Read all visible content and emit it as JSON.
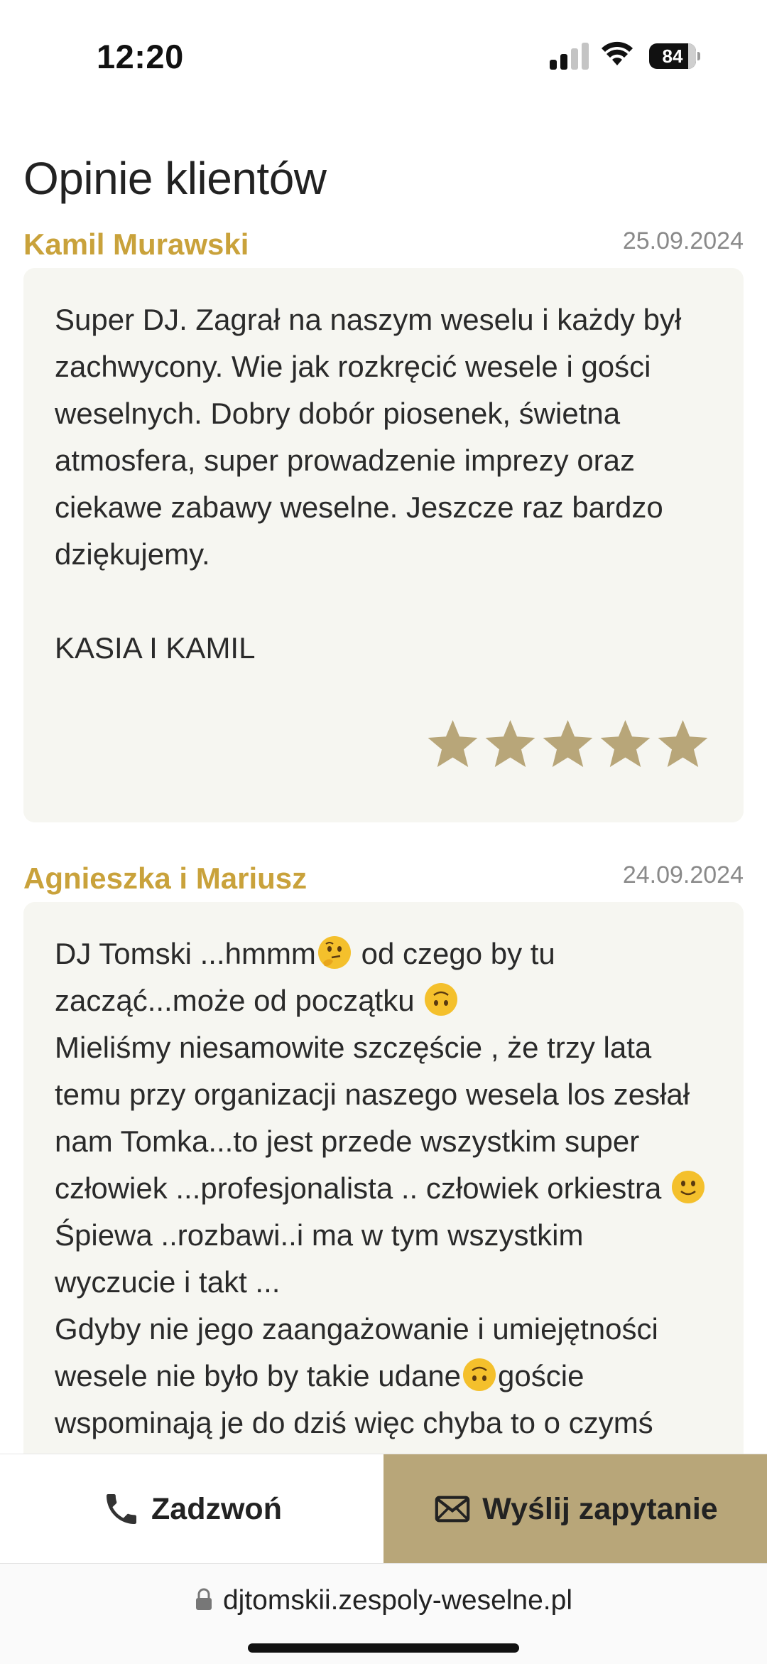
{
  "status_bar": {
    "time": "12:20",
    "battery": "84",
    "icons": [
      "signal-icon",
      "wifi-icon",
      "battery-icon"
    ]
  },
  "section": {
    "title": "Opinie klientów"
  },
  "reviews": [
    {
      "author": "Kamil Murawski",
      "date": "25.09.2024",
      "text": "Super DJ. Zagrał na naszym weselu i każdy był zachwycony. Wie jak rozkręcić wesele i gości weselnych. Dobry dobór piosenek, świetna atmosfera, super prowadzenie imprezy oraz ciekawe zabawy weselne. Jeszcze raz bardzo dziękujemy.",
      "signature": "KASIA I KAMIL",
      "rating": 5
    },
    {
      "author": "Agnieszka i Mariusz",
      "date": "24.09.2024",
      "text_1": "DJ Tomski ...hmmm",
      "text_2": " od czego by tu zacząć...może od początku ",
      "text_3": "Mieliśmy niesamowite szczęście , że trzy lata temu przy organizacji naszego wesela los zesłał nam Tomka...to jest przede wszystkim super człowiek ...profesjonalista .. człowiek orkiestra ",
      "text_4": " Śpiewa ..rozbawi..i ma w tym wszystkim wyczucie i takt ...",
      "text_5": "Gdyby nie jego zaangażowanie i umiejętności wesele nie było by takie udane",
      "text_6": "goście wspominają je do dziś więc chyba to o czymś"
    }
  ],
  "actions": {
    "call_label": "Zadzwoń",
    "inquiry_label": "Wyślij zapytanie"
  },
  "browser": {
    "url": "djtomskii.zespoly-weselne.pl"
  },
  "colors": {
    "accent_gold": "#c9a23b",
    "star": "#b8a679",
    "inquiry_button": "#b8a679",
    "card_bg": "#f6f6f1"
  }
}
